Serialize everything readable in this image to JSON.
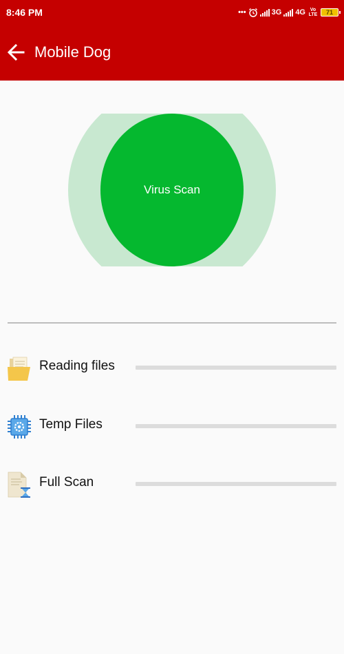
{
  "status_bar": {
    "time": "8:46 PM",
    "dots": "•••",
    "network_1": "3G",
    "network_2": "4G",
    "volte_line1": "Vo",
    "volte_line2": "LTE",
    "battery": "71"
  },
  "toolbar": {
    "title": "Mobile Dog",
    "background": "#c50000"
  },
  "scan": {
    "button_label": "Virus Scan",
    "button_color": "#05b82f",
    "halo_color": "#c8e8d0"
  },
  "scan_items": [
    {
      "label": "Reading files",
      "icon": "folder-icon",
      "progress": 0
    },
    {
      "label": "Temp Files",
      "icon": "cpu-chip-icon",
      "progress": 0
    },
    {
      "label": "Full Scan",
      "icon": "document-hourglass-icon",
      "progress": 0
    }
  ]
}
